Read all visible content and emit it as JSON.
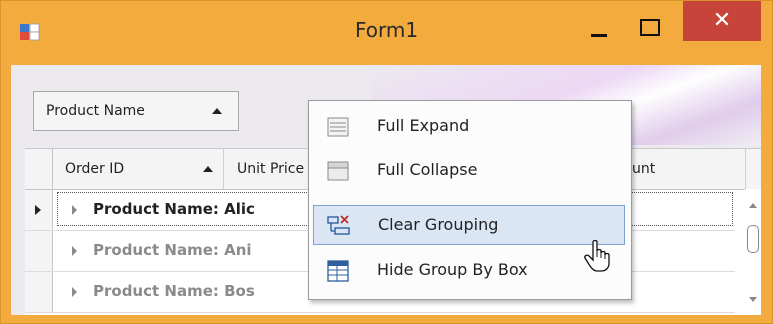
{
  "window": {
    "title": "Form1",
    "close_glyph": "✕",
    "icons": {
      "app": "app-window-icon",
      "minimize": "minimize-icon",
      "maximize": "maximize-icon",
      "close": "close-icon"
    }
  },
  "group_panel": {
    "chip_label": "Product Name",
    "chip_sort": "ascending"
  },
  "grid": {
    "columns": [
      {
        "label": "Order ID",
        "sort": "ascending"
      },
      {
        "label": "Unit Price"
      },
      {
        "label": "unt"
      }
    ],
    "group_rows": [
      {
        "text": "Product Name: Alic",
        "focused": true
      },
      {
        "text": "Product Name: Ani",
        "focused": false
      },
      {
        "text": "Product Name: Bos",
        "focused": false
      }
    ]
  },
  "context_menu": {
    "items": [
      {
        "label": "Full Expand",
        "icon": "full-expand-icon"
      },
      {
        "label": "Full Collapse",
        "icon": "full-collapse-icon"
      },
      {
        "label": "Clear Grouping",
        "icon": "clear-grouping-icon",
        "hovered": true
      },
      {
        "label": "Hide Group By Box",
        "icon": "hide-group-box-icon"
      }
    ]
  },
  "colors": {
    "title_bar": "#f2ab3c",
    "close_button": "#c7443a",
    "menu_hover": "#dbe6f4",
    "menu_hover_border": "#7da2ce",
    "icon_blue": "#2f5f9e",
    "icon_red": "#c62828"
  }
}
